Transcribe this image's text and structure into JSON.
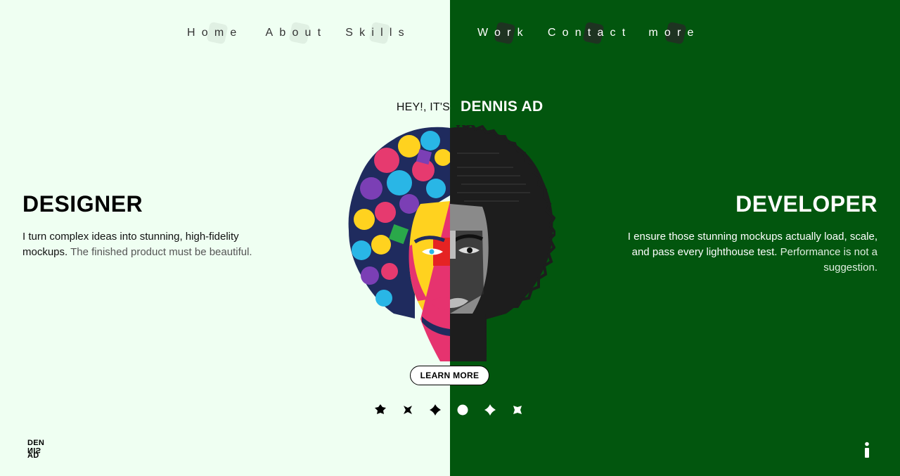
{
  "nav": {
    "left": [
      "Home",
      "About",
      "Skills"
    ],
    "right": [
      "Work",
      "Contact",
      "more"
    ]
  },
  "hero": {
    "greeting": "HEY!, IT'S",
    "name": "DENNIS AD",
    "cta": "LEARN MORE"
  },
  "designer": {
    "title": "DESIGNER",
    "text_main": "I turn complex ideas into stunning, high-fidelity mockups.",
    "text_muted": "The finished product must be beautiful."
  },
  "developer": {
    "title": "DEVELOPER",
    "text_main": "I ensure those stunning mockups actually load, scale, and pass every lighthouse test.",
    "text_muted": "Performance is not a suggestion."
  },
  "logo": {
    "line1": "DEN",
    "line2": "NIS",
    "line3": "AD"
  },
  "slider": {
    "count": 6,
    "active_index": 3
  },
  "colors": {
    "left_bg": "#effff2",
    "right_bg": "#02560e"
  },
  "icons": {
    "info": "info-icon"
  }
}
